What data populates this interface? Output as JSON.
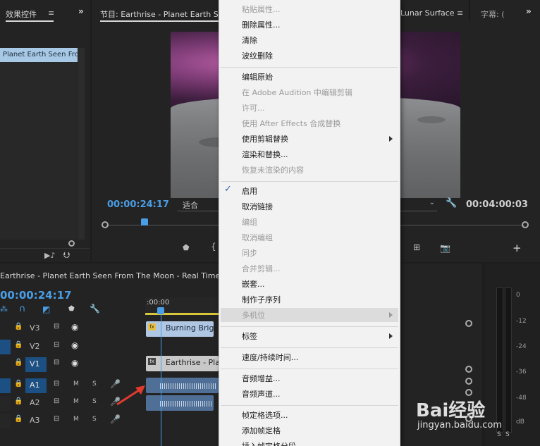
{
  "effects_panel": {
    "title": "效果控件",
    "clip_name": "Planet Earth Seen Fro"
  },
  "program_monitor": {
    "title": "节目: Earthrise - Planet Earth Se",
    "title_tail": "Lunar Surface",
    "captions_tab": "字幕: (",
    "current_time": "00:00:24:17",
    "fit_label": "适合",
    "duration": "00:04:00:03"
  },
  "timeline": {
    "title": "Earthrise - Planet Earth Seen From The Moon - Real Time Jou",
    "current_time": "00:00:24:17",
    "ruler_start": ":00:00",
    "tracks": [
      {
        "label": "V3",
        "kind": "video"
      },
      {
        "label": "V2",
        "kind": "video"
      },
      {
        "label": "V1",
        "kind": "video"
      },
      {
        "label": "A1",
        "kind": "audio",
        "m": "M",
        "s": "S"
      },
      {
        "label": "A2",
        "kind": "audio",
        "m": "M",
        "s": "S"
      },
      {
        "label": "A3",
        "kind": "audio",
        "m": "M",
        "s": "S"
      }
    ],
    "clips": {
      "v3": "Burning Brigh",
      "v1": "Earthrise - Pla",
      "fx": "fx"
    }
  },
  "audio_meter": {
    "ticks": [
      "0",
      "-12",
      "-24",
      "-36",
      "-48",
      "dB"
    ],
    "solo": [
      "S",
      "S"
    ]
  },
  "context_menu": {
    "items": [
      {
        "label": "粘贴属性...",
        "disabled": true
      },
      {
        "label": "删除属性...",
        "disabled": false
      },
      {
        "label": "清除",
        "disabled": false
      },
      {
        "label": "波纹删除",
        "disabled": false
      },
      {
        "sep": true
      },
      {
        "label": "编辑原始",
        "disabled": false
      },
      {
        "label": "在 Adobe Audition 中编辑剪辑",
        "disabled": true
      },
      {
        "label": "许可...",
        "disabled": true
      },
      {
        "label": "使用 After Effects 合成替换",
        "disabled": true
      },
      {
        "label": "使用剪辑替换",
        "disabled": false,
        "submenu": true
      },
      {
        "label": "渲染和替换...",
        "disabled": false
      },
      {
        "label": "恢复未渲染的内容",
        "disabled": true
      },
      {
        "sep": true
      },
      {
        "label": "启用",
        "disabled": false,
        "checked": true
      },
      {
        "label": "取消链接",
        "disabled": false
      },
      {
        "label": "编组",
        "disabled": true
      },
      {
        "label": "取消编组",
        "disabled": true
      },
      {
        "label": "同步",
        "disabled": true
      },
      {
        "label": "合并剪辑...",
        "disabled": true
      },
      {
        "label": "嵌套...",
        "disabled": false
      },
      {
        "label": "制作子序列",
        "disabled": false
      },
      {
        "label": "多机位",
        "disabled": true,
        "submenu": true,
        "highlight": true
      },
      {
        "sep": true
      },
      {
        "label": "标签",
        "disabled": false,
        "submenu": true
      },
      {
        "sep": true
      },
      {
        "label": "速度/持续时间...",
        "disabled": false
      },
      {
        "sep": true
      },
      {
        "label": "音频增益...",
        "disabled": false
      },
      {
        "label": "音频声道...",
        "disabled": false
      },
      {
        "sep": true
      },
      {
        "label": "帧定格选项...",
        "disabled": false
      },
      {
        "label": "添加帧定格",
        "disabled": false
      },
      {
        "label": "插入帧定格分段",
        "disabled": false
      }
    ]
  },
  "watermark": {
    "brand": "Bai经验",
    "url": "jingyan.baidu.com"
  },
  "colors": {
    "accent": "#4a9ee6",
    "panel": "#232323",
    "menu": "#f2f2f2"
  }
}
